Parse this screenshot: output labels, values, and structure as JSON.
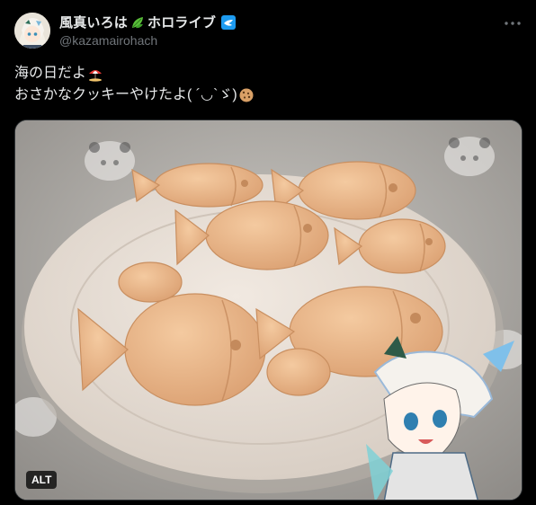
{
  "author": {
    "display_name": "風真いろは",
    "org_name": "ホロライブ",
    "handle": "@kazamairohach"
  },
  "post": {
    "line1": "海の日だよ",
    "line2": "おさかなクッキーやけたよ( ´◡`ゞ)"
  },
  "media": {
    "alt_label": "ALT"
  },
  "icons": {
    "leaf": "leaf-emoji-icon",
    "verified": "verified-badge-icon",
    "more": "more-options-icon",
    "beach": "beach-umbrella-emoji-icon",
    "cookie": "cookie-emoji-icon"
  },
  "colors": {
    "background": "#000000",
    "text": "#e7e9ea",
    "secondary_text": "#71767b",
    "verified": "#1d9bf0"
  }
}
